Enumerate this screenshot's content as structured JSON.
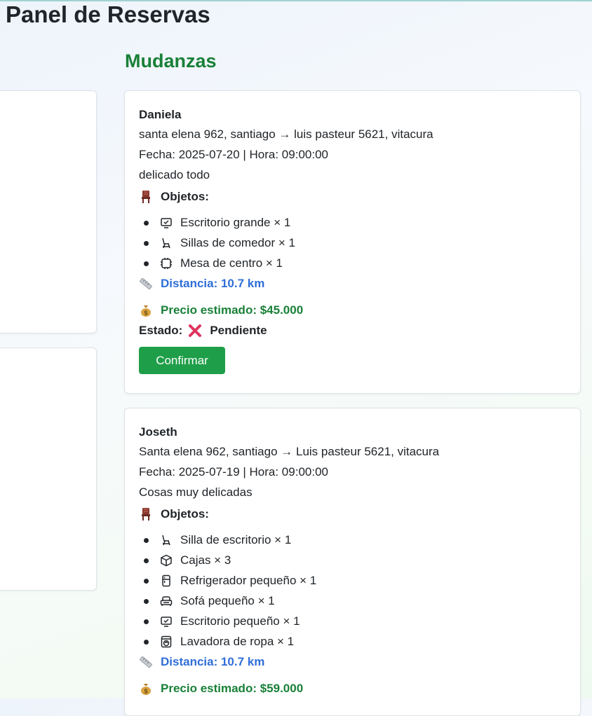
{
  "page": {
    "title": "Panel de Reservas"
  },
  "section": {
    "title": "Mudanzas"
  },
  "reservations": [
    {
      "name": "Daniela",
      "route": "santa elena 962, santiago → luis pasteur 5621, vitacura",
      "datetime": "Fecha: 2025-07-20 | Hora: 09:00:00",
      "notes": "delicado todo",
      "objects_label": "Objetos:",
      "items": [
        {
          "icon": "desk-icon",
          "text": "Escritorio grande × 1"
        },
        {
          "icon": "chair-icon",
          "text": "Sillas de comedor × 1"
        },
        {
          "icon": "table-icon",
          "text": "Mesa de centro × 1"
        }
      ],
      "distance": "Distancia: 10.7 km",
      "price": "Precio estimado: $45.000",
      "status_label": "Estado:",
      "status": "Pendiente",
      "confirm_label": "Confirmar"
    },
    {
      "name": "Joseth",
      "route": "Santa elena 962, santiago → Luis pasteur 5621, vitacura",
      "datetime": "Fecha: 2025-07-19 | Hora: 09:00:00",
      "notes": "Cosas muy delicadas",
      "objects_label": "Objetos:",
      "items": [
        {
          "icon": "chair-icon",
          "text": "Silla de escritorio × 1"
        },
        {
          "icon": "box-icon",
          "text": "Cajas × 3"
        },
        {
          "icon": "fridge-icon",
          "text": "Refrigerador pequeño × 1"
        },
        {
          "icon": "sofa-icon",
          "text": "Sofá pequeño × 1"
        },
        {
          "icon": "desk-icon",
          "text": "Escritorio pequeño × 1"
        },
        {
          "icon": "washer-icon",
          "text": "Lavadora de ropa × 1"
        }
      ],
      "distance": "Distancia: 10.7 km",
      "price": "Precio estimado: $59.000"
    }
  ],
  "colors": {
    "accent_green": "#198038",
    "button_green": "#1e9e48",
    "link_blue": "#2f6ed8",
    "status_red": "#e0345f"
  }
}
